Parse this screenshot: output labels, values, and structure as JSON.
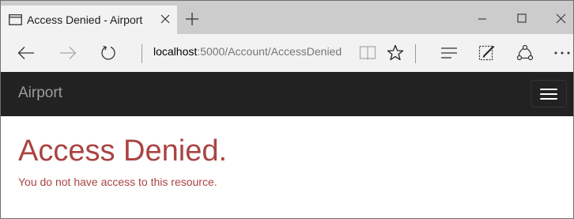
{
  "browser": {
    "tab": {
      "title": "Access Denied - Airport",
      "page_icon": "page-icon",
      "close_icon": "close-icon"
    },
    "new_tab_icon": "plus-icon",
    "window_controls": [
      "minimize-icon",
      "maximize-icon",
      "close-icon"
    ],
    "address": {
      "host": "localhost",
      "path": ":5000/Account/AccessDenied"
    },
    "toolbar_icons": [
      "reading-view-icon",
      "favorite-star-icon",
      "hub-icon",
      "web-note-icon",
      "share-icon",
      "more-icon"
    ],
    "nav_icons": [
      "back-icon",
      "forward-icon",
      "refresh-icon"
    ]
  },
  "site": {
    "brand": "Airport",
    "menu_icon": "hamburger-icon",
    "navbar_color": "#222222"
  },
  "page": {
    "heading": "Access Denied.",
    "message": "You do not have access to this resource.",
    "error_color": "#a94442"
  }
}
